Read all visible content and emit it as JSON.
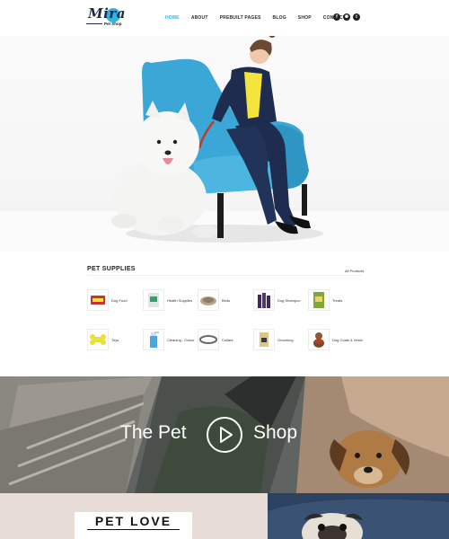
{
  "brand": {
    "name": "Mira",
    "tagline": "Pet Shop"
  },
  "nav": {
    "items": [
      {
        "label": "HOME",
        "active": true
      },
      {
        "label": "ABOUT",
        "active": false
      },
      {
        "label": "PREBUILT PAGES",
        "active": false
      },
      {
        "label": "BLOG",
        "active": false
      },
      {
        "label": "SHOP",
        "active": false
      },
      {
        "label": "CONTACT",
        "active": false
      }
    ]
  },
  "social": [
    {
      "icon": "facebook-icon",
      "glyph": "f"
    },
    {
      "icon": "dribbble-icon",
      "glyph": "✺"
    },
    {
      "icon": "twitter-icon",
      "glyph": "t"
    }
  ],
  "supplies": {
    "title": "PET SUPPLIES",
    "all_link": "All Products",
    "categories": [
      {
        "label": "Dog Food",
        "icon": "dog-food-icon"
      },
      {
        "label": "Health Supplies",
        "icon": "health-supplies-icon"
      },
      {
        "label": "Beds",
        "icon": "bed-icon"
      },
      {
        "label": "Dog Shampoo",
        "icon": "shampoo-icon"
      },
      {
        "label": "Treats",
        "icon": "treats-icon"
      },
      {
        "label": "Toys",
        "icon": "toy-icon"
      },
      {
        "label": "Cleaning - Odour",
        "icon": "cleaning-icon"
      },
      {
        "label": "Collars",
        "icon": "collar-icon"
      },
      {
        "label": "Grooming",
        "icon": "grooming-icon"
      },
      {
        "label": "Dog Coats & Vests",
        "icon": "dog-coat-icon"
      }
    ]
  },
  "banner": {
    "left_text": "The Pet",
    "right_text": "Shop"
  },
  "bottom": {
    "title": "PET LOVE"
  },
  "colors": {
    "accent": "#2fb4e6",
    "chair": "#3aa7d6",
    "suit": "#1e2d4f",
    "blouse": "#f4e33a"
  }
}
